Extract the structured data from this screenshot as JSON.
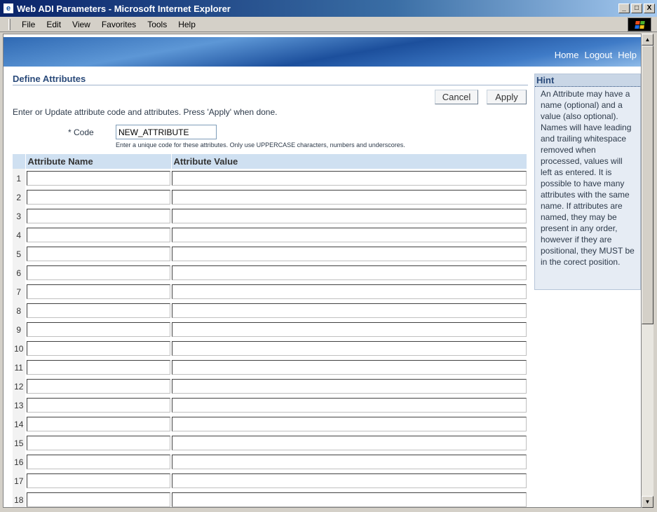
{
  "window": {
    "title": "Web ADI Parameters - Microsoft Internet Explorer",
    "minimize": "_",
    "maximize": "□",
    "close": "X"
  },
  "menu": [
    "File",
    "Edit",
    "View",
    "Favorites",
    "Tools",
    "Help"
  ],
  "header_links": {
    "home": "Home",
    "logout": "Logout",
    "help": "Help"
  },
  "page": {
    "title": "Define Attributes",
    "cancel_label": "Cancel",
    "apply_label": "Apply",
    "instruction": "Enter or Update attribute code and attributes. Press 'Apply' when done.",
    "code_label": "* Code",
    "code_value": "NEW_ATTRIBUTE",
    "code_tip": "Enter a unique code for these attributes. Only use UPPERCASE characters, numbers and underscores."
  },
  "table": {
    "headers": [
      "Attribute Name",
      "Attribute Value"
    ],
    "rows": [
      "1",
      "2",
      "3",
      "4",
      "5",
      "6",
      "7",
      "8",
      "9",
      "10",
      "11",
      "12",
      "13",
      "14",
      "15",
      "16",
      "17",
      "18"
    ]
  },
  "hint": {
    "title": "Hint",
    "text": "An Attribute may have a name (optional) and a value (also optional). Names will have leading and trailing whitespace removed when processed, values will left as entered. It is possible to have many attributes with the same name. If attributes are named, they may be present in any order, however if they are positional, they MUST be in the corect position."
  },
  "colors": {
    "title_bar": "#0a246a",
    "section_title": "#2a4a7a",
    "table_header": "#cfe0f1",
    "hint_bg": "#e6ecf4"
  }
}
